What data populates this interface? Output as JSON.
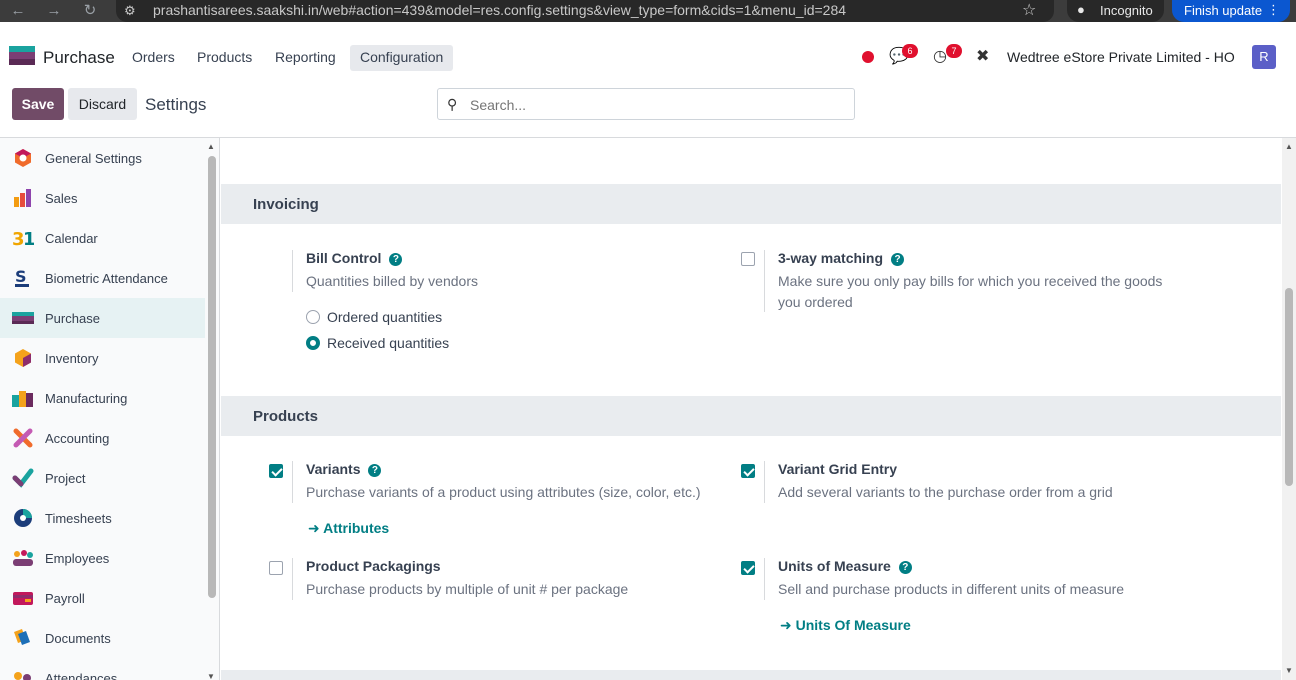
{
  "browser": {
    "url": "prashantisarees.saakshi.in/web#action=439&model=res.config.settings&view_type=form&cids=1&menu_id=284",
    "incognito_label": "Incognito",
    "finish_update_label": "Finish update"
  },
  "navbar": {
    "app_name": "Purchase",
    "menus": [
      "Orders",
      "Products",
      "Reporting",
      "Configuration"
    ],
    "active_menu": "Configuration",
    "messages_count": "6",
    "activities_count": "7",
    "company": "Wedtree eStore Private Limited - HO",
    "avatar_letter": "R"
  },
  "control_panel": {
    "save_label": "Save",
    "discard_label": "Discard",
    "title": "Settings",
    "search_placeholder": "Search..."
  },
  "sidebar": {
    "items": [
      {
        "label": "General Settings",
        "icon": "settings-icon"
      },
      {
        "label": "Sales",
        "icon": "sales-icon"
      },
      {
        "label": "Calendar",
        "icon": "calendar-icon"
      },
      {
        "label": "Biometric Attendance",
        "icon": "cams-icon"
      },
      {
        "label": "Purchase",
        "icon": "purchase-icon",
        "active": true
      },
      {
        "label": "Inventory",
        "icon": "inventory-icon"
      },
      {
        "label": "Manufacturing",
        "icon": "manufacturing-icon"
      },
      {
        "label": "Accounting",
        "icon": "accounting-icon"
      },
      {
        "label": "Project",
        "icon": "project-icon"
      },
      {
        "label": "Timesheets",
        "icon": "timesheets-icon"
      },
      {
        "label": "Employees",
        "icon": "employees-icon"
      },
      {
        "label": "Payroll",
        "icon": "payroll-icon"
      },
      {
        "label": "Documents",
        "icon": "documents-icon"
      },
      {
        "label": "Attendances",
        "icon": "attendances-icon"
      }
    ]
  },
  "invoicing": {
    "header": "Invoicing",
    "bill_control": {
      "title": "Bill Control",
      "description": "Quantities billed by vendors",
      "options": [
        "Ordered quantities",
        "Received quantities"
      ],
      "selected": "Received quantities"
    },
    "three_way": {
      "title": "3-way matching",
      "description_line1": "Make sure you only pay bills for which you received the goods",
      "description_line2": "you ordered",
      "checked": false
    }
  },
  "products": {
    "header": "Products",
    "variants": {
      "title": "Variants",
      "description": "Purchase variants of a product using attributes (size, color, etc.)",
      "link": "Attributes",
      "checked": true
    },
    "variant_grid": {
      "title": "Variant Grid Entry",
      "description": "Add several variants to the purchase order from a grid",
      "checked": true
    },
    "packagings": {
      "title": "Product Packagings",
      "description": "Purchase products by multiple of unit # per package",
      "checked": false
    },
    "uom": {
      "title": "Units of Measure",
      "description": "Sell and purchase products in different units of measure",
      "link": "Units Of Measure",
      "checked": true
    }
  },
  "colors": {
    "brand": "#714b67",
    "accent": "#017e84",
    "badge": "#e0102e"
  }
}
